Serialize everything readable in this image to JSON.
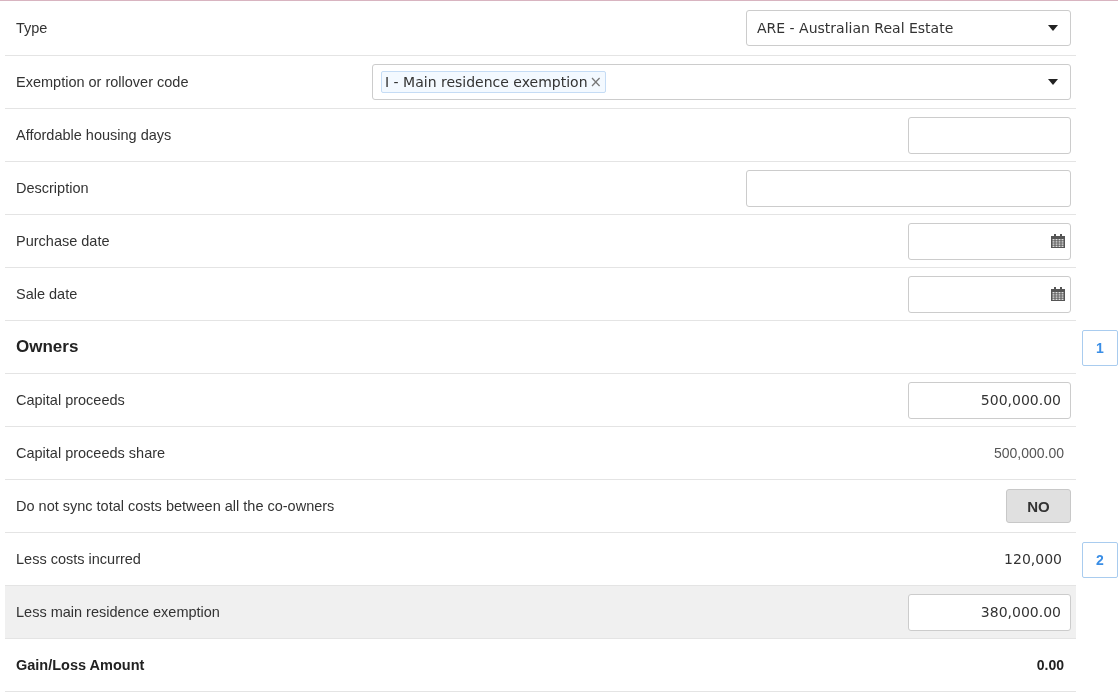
{
  "rows": [
    {
      "kind": "select",
      "label": "Type",
      "value": "ARE - Australian Real Estate",
      "highlighted": false
    },
    {
      "kind": "tags",
      "label": "Exemption or rollover code",
      "tags": [
        {
          "text": "I - Main residence exemption",
          "remove": "×"
        }
      ],
      "highlighted": false
    },
    {
      "kind": "input",
      "label": "Affordable housing days",
      "value": "",
      "highlighted": false
    },
    {
      "kind": "text",
      "label": "Description",
      "value": "",
      "highlighted": false
    },
    {
      "kind": "date",
      "label": "Purchase date",
      "value": "",
      "highlighted": false
    },
    {
      "kind": "date",
      "label": "Sale date",
      "value": "",
      "highlighted": false
    },
    {
      "kind": "heading",
      "label": "Owners",
      "badge": "1",
      "highlighted": false
    },
    {
      "kind": "input",
      "label": "Capital proceeds",
      "value": "500,000.00",
      "highlighted": false
    },
    {
      "kind": "value",
      "label": "Capital proceeds share",
      "value": "500,000.00",
      "highlighted": false
    },
    {
      "kind": "toggle",
      "label": "Do not sync total costs between all the co-owners",
      "on": false,
      "value": "NO",
      "highlighted": false
    },
    {
      "kind": "amount",
      "label": "Less costs incurred",
      "value": "120,000",
      "badge": "2",
      "highlighted": false
    },
    {
      "kind": "input",
      "label": "Less main residence exemption",
      "value": "380,000.00",
      "highlighted": true
    },
    {
      "kind": "total",
      "label": "Gain/Loss Amount",
      "value": "0.00",
      "highlighted": false
    }
  ]
}
